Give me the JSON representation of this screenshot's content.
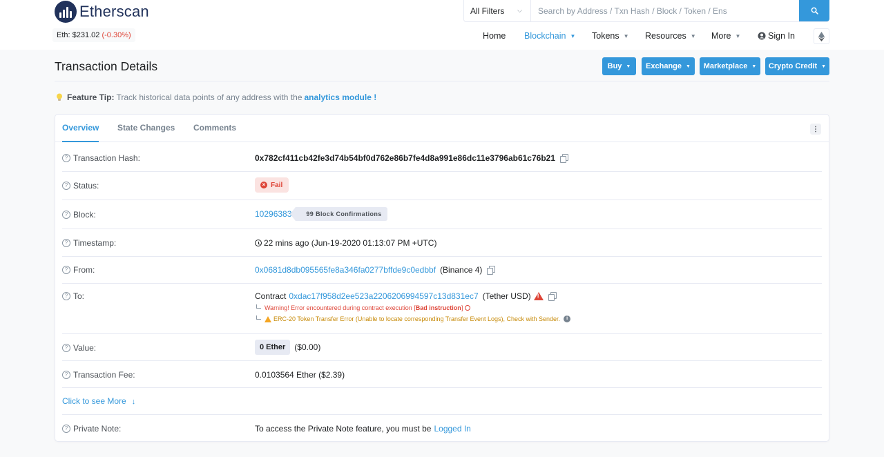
{
  "header": {
    "brand": "Etherscan",
    "eth_price_label": "Eth: $231.02",
    "eth_change": "(-0.30%)",
    "filter_label": "All Filters",
    "search_placeholder": "Search by Address / Txn Hash / Block / Token / Ens",
    "nav": [
      "Home",
      "Blockchain",
      "Tokens",
      "Resources",
      "More"
    ],
    "sign_in": "Sign In"
  },
  "page": {
    "title": "Transaction Details",
    "buttons": [
      "Buy",
      "Exchange",
      "Marketplace",
      "Crypto Credit"
    ],
    "tip_label": "Feature Tip:",
    "tip_text": "Track historical data points of any address with the",
    "tip_link": "analytics module !"
  },
  "tabs": [
    "Overview",
    "State Changes",
    "Comments"
  ],
  "details": {
    "hash_label": "Transaction Hash:",
    "hash": "0x782cf411cb42fe3d74b54bf0d762e86b7fe4d8a991e86dc11e3796ab61c76b21",
    "status_label": "Status:",
    "status": "Fail",
    "block_label": "Block:",
    "block": "10296383",
    "confirmations": "99 Block Confirmations",
    "timestamp_label": "Timestamp:",
    "timestamp": "22 mins ago (Jun-19-2020 01:13:07 PM +UTC)",
    "from_label": "From:",
    "from_address": "0x0681d8db095565fe8a346fa0277bffde9c0edbbf",
    "from_name": "(Binance 4)",
    "to_label": "To:",
    "to_prefix": "Contract",
    "to_address": "0xdac17f958d2ee523a2206206994597c13d831ec7",
    "to_name": "(Tether USD)",
    "warning_text": "Warning! Error encountered during contract execution [",
    "warning_bold": "Bad instruction",
    "warning_close": "]",
    "erc20_error": "ERC-20 Token Transfer Error (Unable to locate corresponding Transfer Event Logs), Check with Sender.",
    "value_label": "Value:",
    "value": "0 Ether",
    "value_usd": "($0.00)",
    "fee_label": "Transaction Fee:",
    "fee": "0.0103564 Ether ($2.39)",
    "see_more": "Click to see More",
    "note_label": "Private Note:",
    "note_text": "To access the Private Note feature, you must be",
    "note_link": "Logged In"
  },
  "colors": {
    "accent": "#3498db",
    "brand": "#21325b",
    "error": "#de4437",
    "warning": "#f5a623"
  },
  "icons": [
    "etherscan-logo-icon",
    "chevron-down-icon",
    "search-icon",
    "user-circle-icon",
    "ethereum-icon",
    "lightbulb-icon",
    "kebab-icon",
    "question-icon",
    "copy-icon",
    "x-circle-icon",
    "clock-icon",
    "warning-icon",
    "sad-face-icon",
    "info-icon",
    "arrow-down-icon"
  ]
}
